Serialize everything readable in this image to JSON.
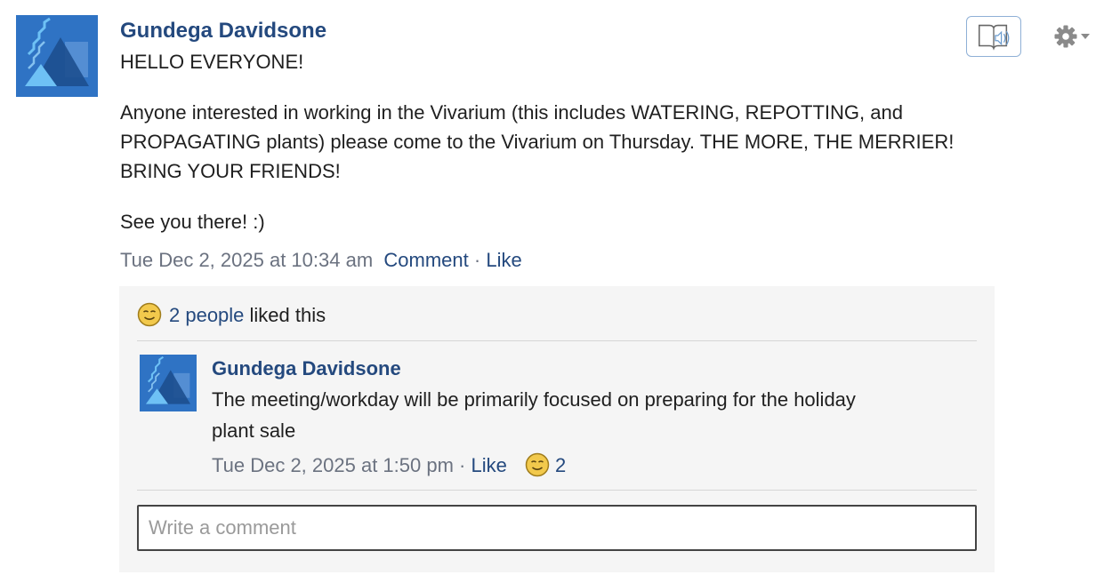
{
  "post": {
    "author": "Gundega Davidsone",
    "body": [
      "HELLO EVERYONE!",
      "Anyone interested in working in the Vivarium (this includes WATERING, REPOTTING, and PROPAGATING plants) please come to the Vivarium on Thursday. THE MORE, THE MERRIER! BRING YOUR FRIENDS!",
      "See you there! :)"
    ],
    "timestamp": "Tue Dec 2, 2025 at 10:34 am",
    "comment_label": "Comment",
    "separator": "·",
    "like_label": "Like"
  },
  "likes": {
    "people_link": "2 people",
    "suffix_text": " liked this"
  },
  "comment": {
    "author": "Gundega Davidsone",
    "body": "The meeting/workday will be primarily focused on preparing for the holiday plant sale",
    "timestamp": "Tue Dec 2, 2025 at 1:50 pm",
    "separator": "·",
    "like_label": "Like",
    "like_count": "2"
  },
  "comment_input": {
    "placeholder": "Write a comment"
  },
  "icons": {
    "avatar": "abstract-geometric-avatar-icon",
    "read_aloud": "read-aloud-icon",
    "settings": "gear-icon",
    "like_reaction": "smiley-icon"
  },
  "colors": {
    "link": "#24497e",
    "avatar_bg": "#2f73c4",
    "panel_bg": "#f5f5f5",
    "muted_text": "#6b7280"
  }
}
